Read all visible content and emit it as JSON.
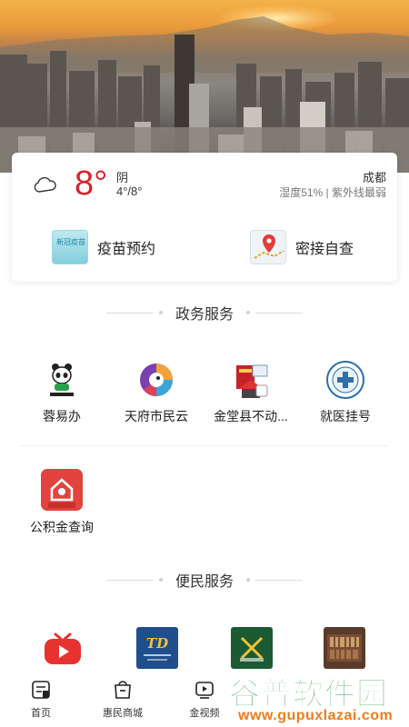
{
  "weather": {
    "temp": "8°",
    "condition": "阴",
    "range": "4°/8°",
    "city": "成都",
    "detail": "湿度51% | 紫外线最弱",
    "icon": "cloud-icon"
  },
  "quick_actions": [
    {
      "label": "疫苗预约",
      "icon": "vaccine-icon",
      "icon_text": "新冠疫苗"
    },
    {
      "label": "密接自查",
      "icon": "map-pin-icon"
    }
  ],
  "gov_section": {
    "title": "政务服务",
    "items": [
      {
        "label": "蓉易办",
        "icon": "panda-icon"
      },
      {
        "label": "天府市民云",
        "icon": "tianfu-cloud-icon"
      },
      {
        "label": "金堂县不动...",
        "icon": "property-register-icon"
      },
      {
        "label": "就医挂号",
        "icon": "hospital-seal-icon"
      },
      {
        "label": "公积金查询",
        "icon": "housing-fund-icon"
      }
    ]
  },
  "life_section": {
    "title": "便民服务",
    "items": [
      {
        "icon": "tv-play-icon"
      },
      {
        "icon": "td-logo-icon"
      },
      {
        "icon": "green-app-icon"
      },
      {
        "icon": "bookshelf-icon"
      }
    ]
  },
  "tabbar": [
    {
      "label": "首页",
      "icon": "home-icon"
    },
    {
      "label": "惠民商城",
      "icon": "shopping-bag-icon"
    },
    {
      "label": "金视频",
      "icon": "video-icon"
    }
  ],
  "watermark": {
    "main": "谷普软件园",
    "url": "www.gupuxlazai.com"
  },
  "colors": {
    "temp_red": "#d9232e",
    "brand_green": "#2aa04a",
    "watermark_orange": "#ee7d1a"
  }
}
